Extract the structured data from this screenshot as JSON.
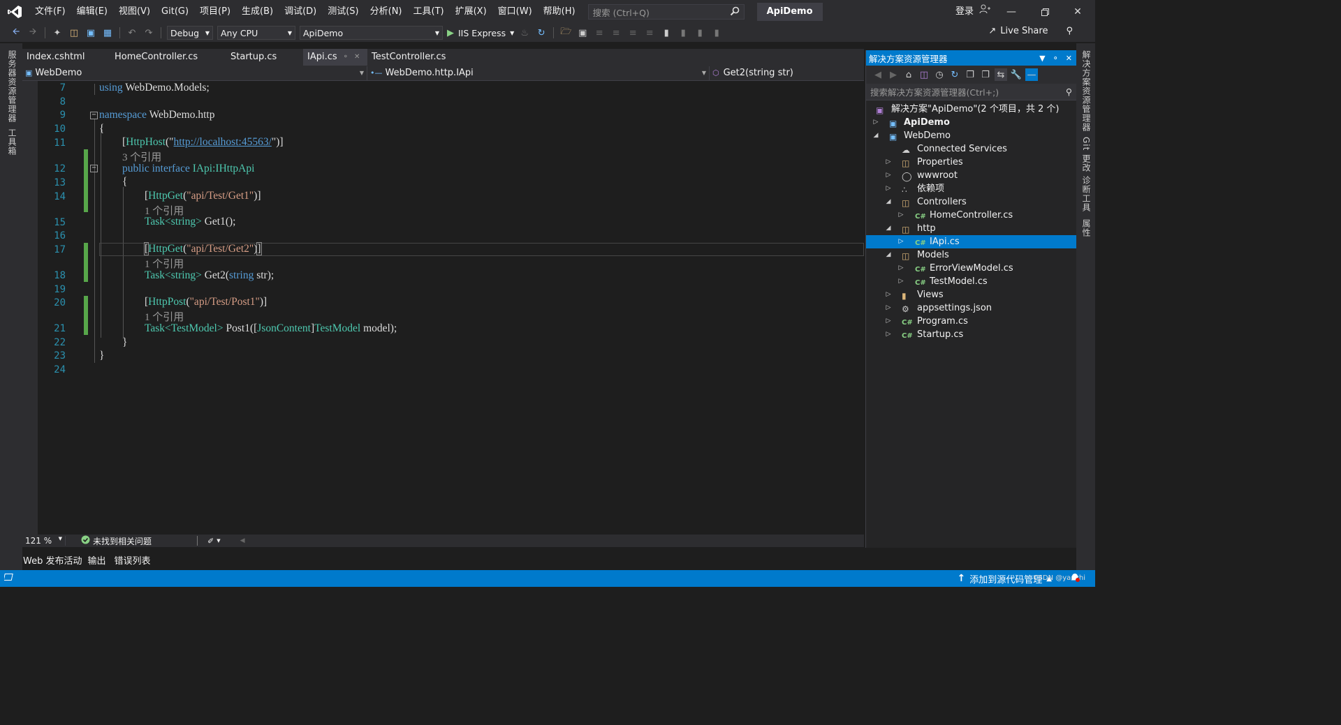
{
  "menu": [
    "文件(F)",
    "编辑(E)",
    "视图(V)",
    "Git(G)",
    "项目(P)",
    "生成(B)",
    "调试(D)",
    "测试(S)",
    "分析(N)",
    "工具(T)",
    "扩展(X)",
    "窗口(W)",
    "帮助(H)"
  ],
  "search_placeholder": "搜索 (Ctrl+Q)",
  "solution_name": "ApiDemo",
  "login_label": "登录",
  "toolbar": {
    "config": "Debug",
    "platform": "Any CPU",
    "startup_project": "ApiDemo",
    "run_label": "IIS Express",
    "live_share": "Live Share"
  },
  "left_strip": [
    "服务器资源管理器",
    "工具箱"
  ],
  "right_strip": [
    "解决方案资源管理器",
    "Git 更改",
    "诊断工具",
    "属性"
  ],
  "tabs": [
    {
      "label": "Index.cshtml"
    },
    {
      "label": "HomeController.cs"
    },
    {
      "label": "Startup.cs"
    },
    {
      "label": "IApi.cs"
    },
    {
      "label": "TestController.cs"
    }
  ],
  "active_tab": "IApi.cs",
  "navbar": {
    "project": "WebDemo",
    "type": "WebDemo.http.IApi",
    "member": "Get2(string str)"
  },
  "code": {
    "l7": "using WebDemo.Models;",
    "l9_kw": "namespace",
    "l9_ns": " WebDemo.http",
    "open_brace": "{",
    "close_brace": "}",
    "l11_attr": "HttpHost",
    "l11_url": "http://localhost:45563/",
    "l12_refs": "3 个引用",
    "l12_mod": "public interface",
    "l12_name": " IApi",
    "l12_base": ":IHttpApi",
    "l14_attr": "HttpGet",
    "l14_str": "\"api/Test/Get1\"",
    "l15_refs": "1 个引用",
    "l15_ret": "Task<string>",
    "l15_name": " Get1();",
    "l17_attr": "HttpGet",
    "l17_str": "\"api/Test/Get2\"",
    "l18_refs": "1 个引用",
    "l18_ret": "Task<string>",
    "l18_name": " Get2(",
    "l18_ptype": "string",
    "l18_rest": " str);",
    "l20_attr": "HttpPost",
    "l20_str": "\"api/Test/Post1\"",
    "l21_refs": "1 个引用",
    "l21_ret": "Task<TestModel>",
    "l21_name": " Post1([",
    "l21_attr": "JsonContent",
    "l21_close": "]",
    "l21_ptype": "TestModel",
    "l21_rest": " model);"
  },
  "line_numbers": [
    "7",
    "8",
    "9",
    "10",
    "11",
    "12",
    "13",
    "14",
    "15",
    "16",
    "17",
    "18",
    "19",
    "20",
    "21",
    "22",
    "23",
    "24"
  ],
  "editor_status": {
    "zoom": "121 %",
    "issues": "未找到相关问题"
  },
  "bottom_tabs": [
    "Web 发布活动",
    "输出",
    "错误列表"
  ],
  "solution_explorer": {
    "title": "解决方案资源管理器",
    "search_placeholder": "搜索解决方案资源管理器(Ctrl+;)",
    "items": [
      {
        "label": "解决方案\"ApiDemo\"(2 个项目，共 2 个)"
      },
      {
        "label": "ApiDemo"
      },
      {
        "label": "WebDemo"
      },
      {
        "label": "Connected Services"
      },
      {
        "label": "Properties"
      },
      {
        "label": "wwwroot"
      },
      {
        "label": "依赖项"
      },
      {
        "label": "Controllers"
      },
      {
        "label": "HomeController.cs"
      },
      {
        "label": "http"
      },
      {
        "label": "IApi.cs"
      },
      {
        "label": "Models"
      },
      {
        "label": "ErrorViewModel.cs"
      },
      {
        "label": "TestModel.cs"
      },
      {
        "label": "Views"
      },
      {
        "label": "appsettings.json"
      },
      {
        "label": "Program.cs"
      },
      {
        "label": "Startup.cs"
      }
    ]
  },
  "statusbar": {
    "source_control": "添加到源代码管理",
    "watermark": "CSDN @yanzhi"
  },
  "colors": {
    "accent": "#007acc",
    "keyword": "#569cd6",
    "type": "#4ec9b0",
    "string": "#d69d85",
    "change_bar": "#57a64a"
  }
}
